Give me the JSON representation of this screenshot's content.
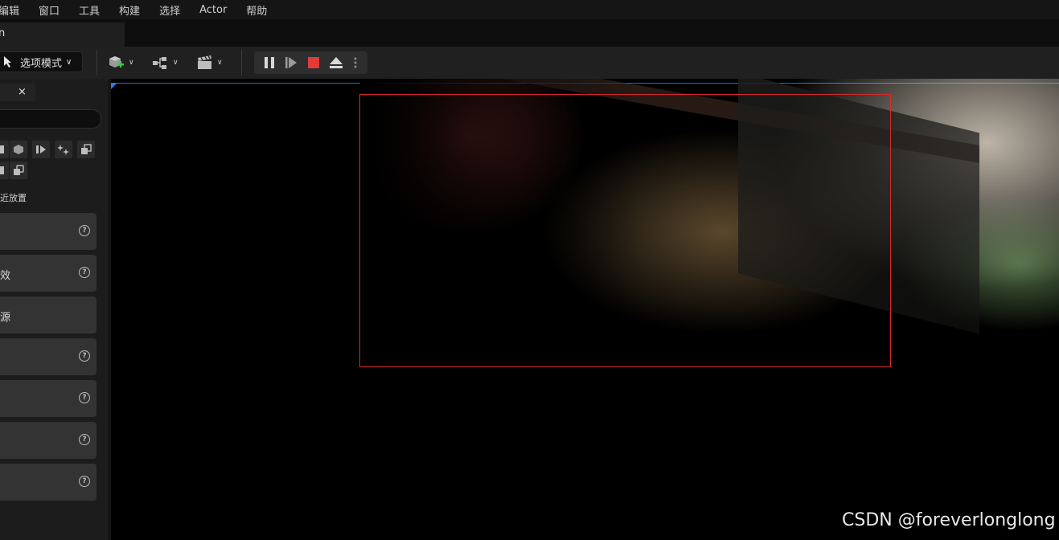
{
  "menubar": {
    "items": [
      "编辑",
      "窗口",
      "工具",
      "构建",
      "选择",
      "Actor",
      "帮助"
    ]
  },
  "tab": {
    "label": "n"
  },
  "toolbar": {
    "mode_label": "选项模式",
    "play_controls": [
      "pause-icon",
      "frame-skip-icon",
      "stop-icon",
      "eject-icon",
      "more-vert-icon"
    ],
    "accent_stop": "#e43a3a"
  },
  "panel": {
    "close_glyph": "×",
    "recent_label": "近放置",
    "categories": [
      "",
      "效",
      "源",
      "",
      "",
      "",
      ""
    ]
  },
  "viewport": {
    "accent": "#1d6fd6",
    "frame_color": "#d42a2a"
  },
  "watermark": "CSDN @foreverlonglong"
}
